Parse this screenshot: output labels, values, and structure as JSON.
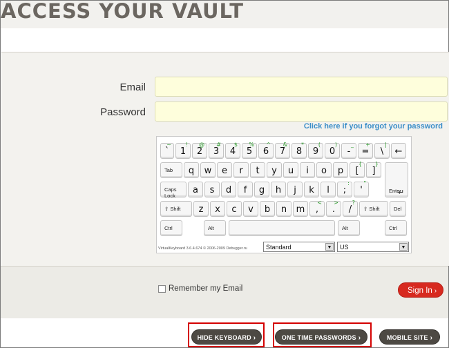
{
  "header": {
    "title": "ACCESS YOUR VAULT"
  },
  "form": {
    "email_label": "Email",
    "password_label": "Password",
    "email_value": "",
    "password_value": "",
    "forgot_link": "Click here if you forgot your password",
    "remember_label": "Remember my Email",
    "remember_checked": false,
    "signin_label": "Sign In"
  },
  "keyboard": {
    "rows": [
      [
        {
          "s": "~",
          "m": "`"
        },
        {
          "s": "!",
          "m": "1"
        },
        {
          "s": "@",
          "m": "2"
        },
        {
          "s": "#",
          "m": "3"
        },
        {
          "s": "$",
          "m": "4"
        },
        {
          "s": "%",
          "m": "5"
        },
        {
          "s": "^",
          "m": "6"
        },
        {
          "s": "&",
          "m": "7"
        },
        {
          "s": "*",
          "m": "8"
        },
        {
          "s": "(",
          "m": "9"
        },
        {
          "s": ")",
          "m": "0"
        },
        {
          "s": "_",
          "m": "-"
        },
        {
          "s": "+",
          "m": "="
        },
        {
          "s": "|",
          "m": "\\"
        },
        {
          "m": "←"
        }
      ],
      [
        {
          "f": "Tab"
        },
        {
          "m": "q"
        },
        {
          "m": "w"
        },
        {
          "m": "e"
        },
        {
          "m": "r"
        },
        {
          "m": "t"
        },
        {
          "m": "y"
        },
        {
          "m": "u"
        },
        {
          "m": "i"
        },
        {
          "m": "o"
        },
        {
          "m": "p"
        },
        {
          "s": "{",
          "m": "["
        },
        {
          "s": "}",
          "m": "]"
        }
      ],
      [
        {
          "f": "Caps Lock"
        },
        {
          "m": "a"
        },
        {
          "m": "s"
        },
        {
          "m": "d"
        },
        {
          "m": "f"
        },
        {
          "m": "g"
        },
        {
          "m": "h"
        },
        {
          "m": "j"
        },
        {
          "m": "k"
        },
        {
          "m": "l"
        },
        {
          "s": ":",
          "m": ";"
        },
        {
          "s": "\"",
          "m": "'"
        },
        {
          "f": "Enter"
        }
      ],
      [
        {
          "f": "⇧ Shift"
        },
        {
          "m": "z"
        },
        {
          "m": "x"
        },
        {
          "m": "c"
        },
        {
          "m": "v"
        },
        {
          "m": "b"
        },
        {
          "m": "n"
        },
        {
          "m": "m"
        },
        {
          "s": "<",
          "m": ","
        },
        {
          "s": ">",
          "m": "."
        },
        {
          "s": "?",
          "m": "/"
        },
        {
          "f": "⇧ Shift"
        },
        {
          "f": "Del"
        }
      ],
      [
        {
          "f": "Ctrl"
        },
        {
          "f": "Alt"
        },
        {
          "m": ""
        },
        {
          "f": "Alt"
        },
        {
          "f": "Ctrl"
        }
      ]
    ],
    "credit": "VirtualKeyboard 3.6.4.674 © 2006-2009 Debugger.ru",
    "layout_select": "Standard",
    "lang_select": "US"
  },
  "footer": {
    "hide_keyboard": "HIDE KEYBOARD",
    "one_time_passwords": "ONE TIME PASSWORDS",
    "mobile_site": "MOBILE SITE",
    "chevron": "›"
  },
  "colors": {
    "accent_red": "#d7291f",
    "pill_dark": "#4d4943",
    "link_blue": "#3b8ec8",
    "field_yellow": "#fefedc"
  }
}
